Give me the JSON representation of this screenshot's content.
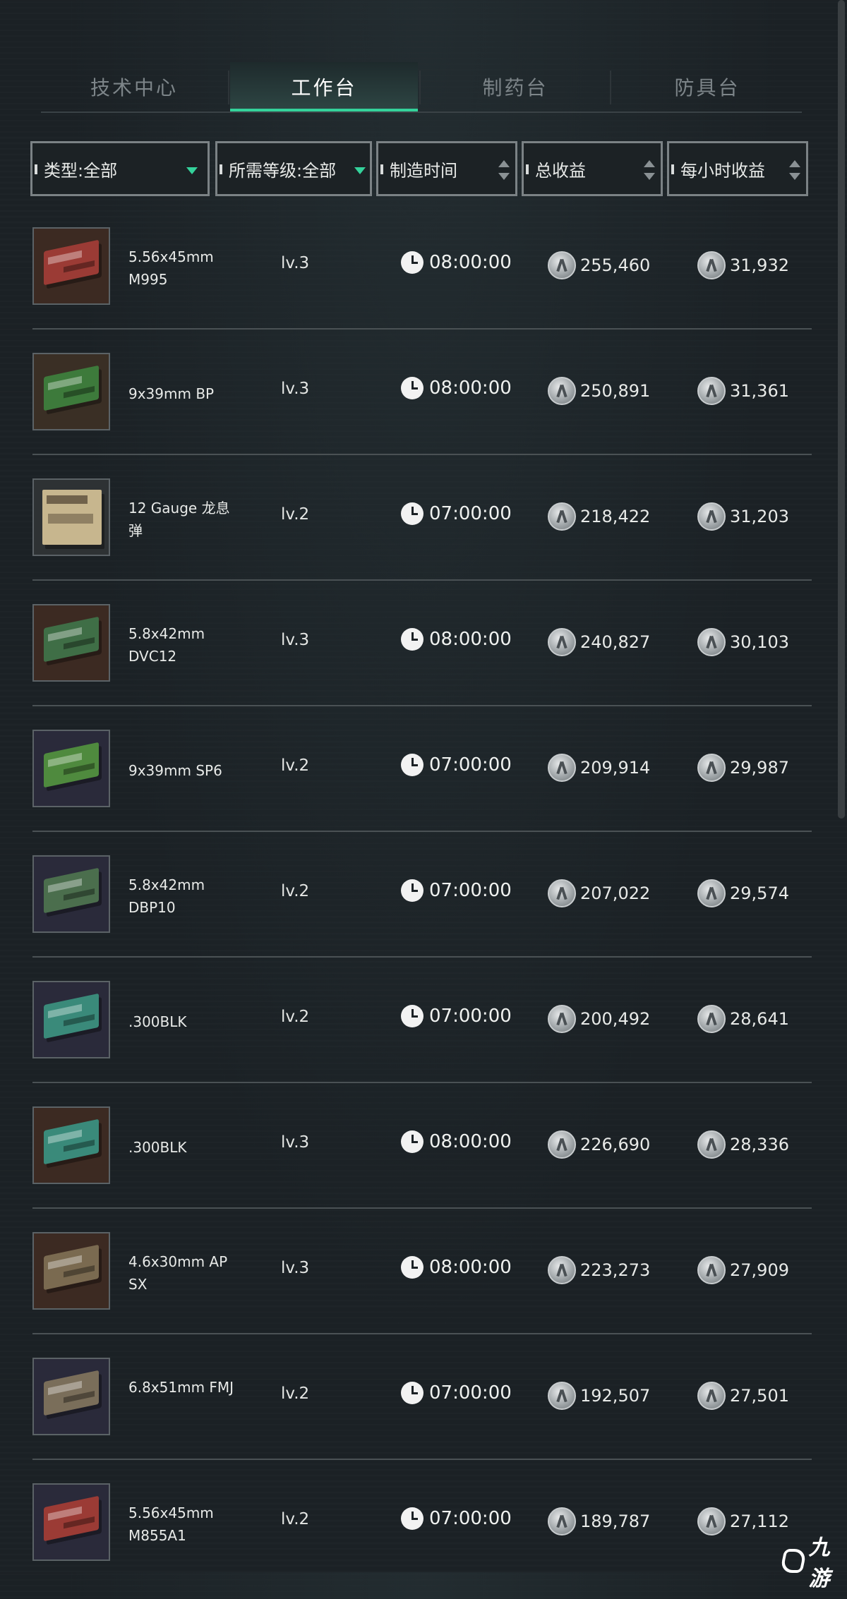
{
  "tabs": [
    {
      "label": "技术中心",
      "active": false
    },
    {
      "label": "工作台",
      "active": true
    },
    {
      "label": "制药台",
      "active": false
    },
    {
      "label": "防具台",
      "active": false
    }
  ],
  "filters": {
    "type": "类型:全部",
    "level": "所需等级:全部",
    "time": "制造时间",
    "total": "总收益",
    "hourly": "每小时收益"
  },
  "colors": {
    "accent": "#34d29b",
    "background": "#1b2125",
    "text": "#e4e6e4"
  },
  "items": [
    {
      "name": "5.56x45mm M995",
      "level": "lv.3",
      "time": "08:00:00",
      "total": "255,460",
      "hourly": "31,932",
      "box_color": "#9b3b35",
      "bg_color": "#3c2a22"
    },
    {
      "name": "9x39mm BP",
      "level": "lv.3",
      "time": "08:00:00",
      "total": "250,891",
      "hourly": "31,361",
      "box_color": "#3d7a3b",
      "bg_color": "#3a2f25"
    },
    {
      "name": "12 Gauge 龙息弹",
      "level": "lv.2",
      "time": "07:00:00",
      "total": "218,422",
      "hourly": "31,203",
      "box_color": "#c7b68e",
      "bg_color": "#2e3234"
    },
    {
      "name": "5.8x42mm DVC12",
      "level": "lv.3",
      "time": "08:00:00",
      "total": "240,827",
      "hourly": "30,103",
      "box_color": "#3f6e46",
      "bg_color": "#3c2a22"
    },
    {
      "name": "9x39mm SP6",
      "level": "lv.2",
      "time": "07:00:00",
      "total": "209,914",
      "hourly": "29,987",
      "box_color": "#4f8a3e",
      "bg_color": "#2a2a3a"
    },
    {
      "name": "5.8x42mm DBP10",
      "level": "lv.2",
      "time": "07:00:00",
      "total": "207,022",
      "hourly": "29,574",
      "box_color": "#4b6e4d",
      "bg_color": "#2a2a3a"
    },
    {
      "name": ".300BLK",
      "level": "lv.2",
      "time": "07:00:00",
      "total": "200,492",
      "hourly": "28,641",
      "box_color": "#3a8a7a",
      "bg_color": "#2a2a3a"
    },
    {
      "name": ".300BLK",
      "level": "lv.3",
      "time": "08:00:00",
      "total": "226,690",
      "hourly": "28,336",
      "box_color": "#3a8a7a",
      "bg_color": "#3c2a22"
    },
    {
      "name": "4.6x30mm AP SX",
      "level": "lv.3",
      "time": "08:00:00",
      "total": "223,273",
      "hourly": "27,909",
      "box_color": "#7a6a50",
      "bg_color": "#3c2a22"
    },
    {
      "name": "6.8x51mm FMJ",
      "level": "lv.2",
      "time": "07:00:00",
      "total": "192,507",
      "hourly": "27,501",
      "box_color": "#7a6e5a",
      "bg_color": "#2a2a3a"
    },
    {
      "name": "5.56x45mm M855A1",
      "level": "lv.2",
      "time": "07:00:00",
      "total": "189,787",
      "hourly": "27,112",
      "box_color": "#9b3b35",
      "bg_color": "#2a2a3a"
    }
  ],
  "watermark": {
    "text": "九游"
  }
}
